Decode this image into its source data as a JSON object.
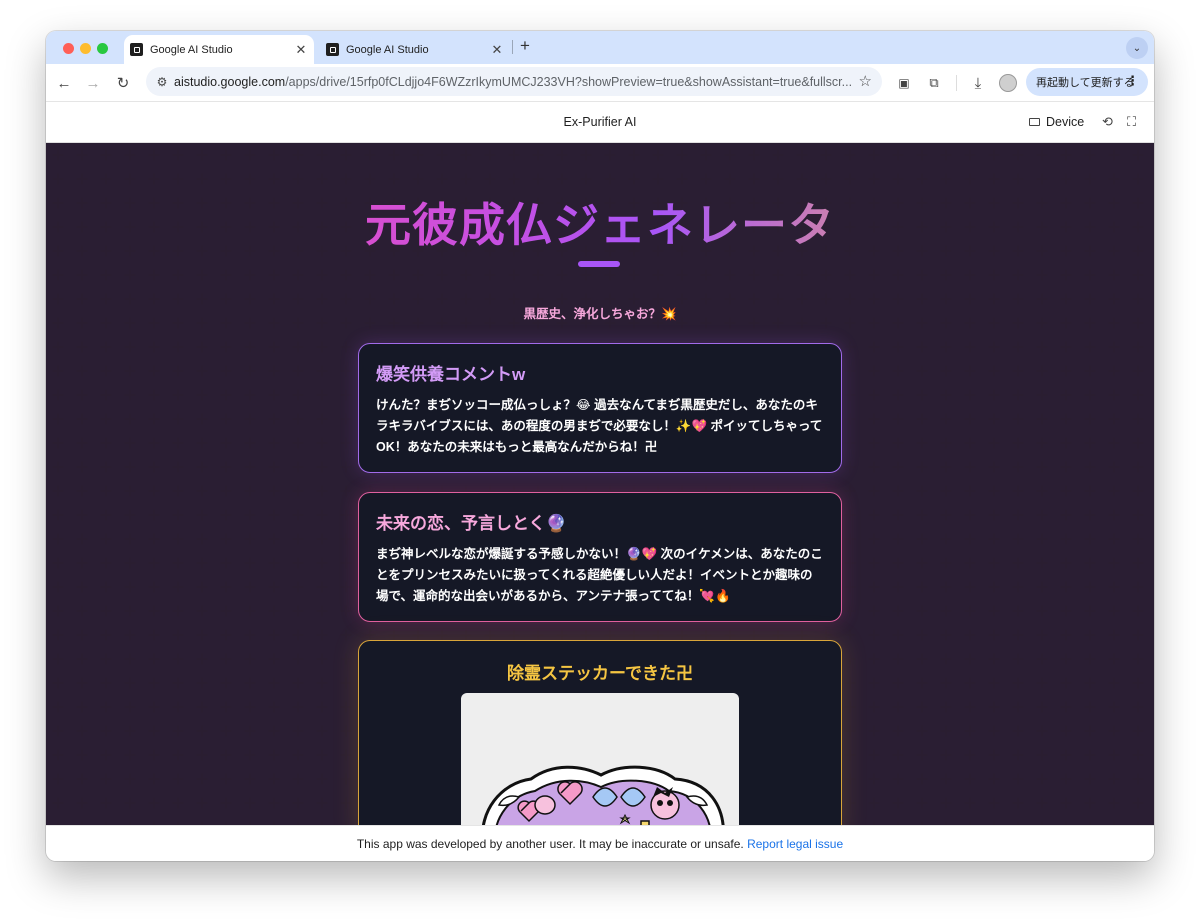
{
  "browser": {
    "tabs": [
      {
        "title": "Google AI Studio",
        "active": true
      },
      {
        "title": "Google AI Studio",
        "active": false
      }
    ],
    "new_tab_icon": "+",
    "url_domain": "aistudio.google.com",
    "url_path": "/apps/drive/15rfp0fCLdjjo4F6WZzrIkymUMCJ233VH?showPreview=true&showAssistant=true&fullscr...",
    "update_button": "再起動して更新する"
  },
  "app_header": {
    "title": "Ex-Purifier AI",
    "device_label": "Device"
  },
  "app": {
    "title": "元彼成仏ジェネレータ",
    "subtitle": "黒歴史、浄化しちゃお？💥",
    "cards": [
      {
        "heading": "爆笑供養コメントw",
        "body": "けんた？まぢソッコー成仏っしょ？😂 過去なんてまぢ黒歴史だし、あなたのキラキラバイブスには、あの程度の男まぢで必要なし！✨💖 ポイッてしちゃってOK！あなたの未来はもっと最高なんだからね！卍"
      },
      {
        "heading": "未来の恋、予言しとく🔮",
        "body": "まぢ神レベルな恋が爆誕する予感しかない！🔮💖 次のイケメンは、あなたのことをプリンセスみたいに扱ってくれる超絶優しい人だよ！イベントとか趣味の場で、運命的な出会いがあるから、アンテナ張っててね！💘🔥"
      },
      {
        "heading": "除霊ステッカーできた卍"
      }
    ]
  },
  "footer": {
    "notice": "This app was developed by another user. It may be inaccurate or unsafe.",
    "link": "Report legal issue"
  },
  "colors": {
    "tabstrip": "#d3e3fd",
    "stage_bg": "#050507",
    "card_bg": "#151826",
    "accent_purple": "#a855f7",
    "accent_pink": "#ec4899",
    "accent_gold": "#f5c542",
    "link": "#1a73e8"
  }
}
